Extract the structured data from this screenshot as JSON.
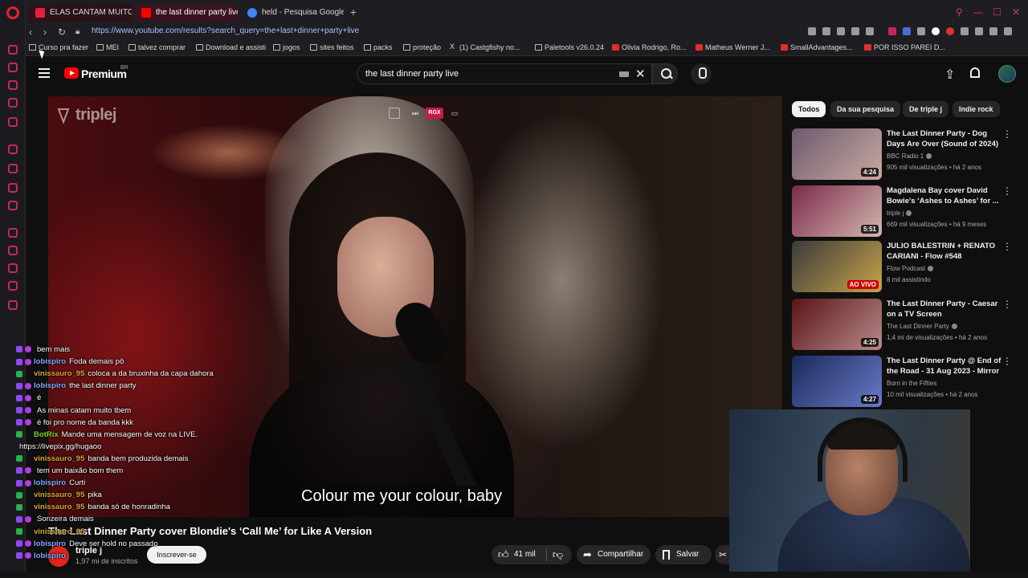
{
  "browser": {
    "tabs": [
      {
        "label": "ELAS CANTAM MUITO!",
        "favicon_color": "#e3203b",
        "active": false
      },
      {
        "label": "the last dinner party live",
        "favicon_color": "#ff0000",
        "active": true
      },
      {
        "label": "held - Pesquisa Google",
        "favicon_color": "#4285f4",
        "active": false
      }
    ],
    "new_tab": "+",
    "url": "https://www.youtube.com/results?search_query=the+last+dinner+party+live",
    "bookmarks": [
      {
        "label": "Curso pra fazer",
        "icon": "folder-icon"
      },
      {
        "label": "MEI",
        "icon": "folder-icon"
      },
      {
        "label": "talvez comprar",
        "icon": "folder-icon"
      },
      {
        "label": "Download e assisti",
        "icon": "folder-icon"
      },
      {
        "label": "jogos",
        "icon": "folder-icon"
      },
      {
        "label": "sites feitos",
        "icon": "folder-icon"
      },
      {
        "label": "packs",
        "icon": "folder-icon"
      },
      {
        "label": "proteção",
        "icon": "folder-icon"
      },
      {
        "label": "(1) Castgfishy no...",
        "icon": "x-icon"
      },
      {
        "label": "Paletools v26.0.24",
        "icon": "page-icon"
      },
      {
        "label": "Olivia Rodrigo, Ro...",
        "icon": "youtube-icon"
      },
      {
        "label": "Matheus Werner J...",
        "icon": "youtube-icon"
      },
      {
        "label": "SmallAdvantages...",
        "icon": "youtube-icon"
      },
      {
        "label": "POR ISSO PAREI D...",
        "icon": "youtube-icon"
      }
    ],
    "accent": "#c8265a"
  },
  "youtube": {
    "brand": "Premium",
    "region": "BR",
    "search_query": "the last dinner party live",
    "chips": [
      "Todos",
      "Da sua pesquisa",
      "De triple j",
      "Indie rock"
    ],
    "video": {
      "watermark": "triplej",
      "rgx_label": "RGX",
      "subtitle": "Colour me your colour, baby",
      "title": "The Last Dinner Party cover Blondie's ‘Call Me’ for Like A Version",
      "channel": "triple j",
      "subscribers": "1,97 mi de inscritos",
      "subscribe_label": "Inscrever-se",
      "likes": "41 mil",
      "share_label": "Compartilhar",
      "save_label": "Salvar"
    },
    "recommendations": [
      {
        "title": "The Last Dinner Party - Dog Days Are Over (Sound of 2024)",
        "channel": "BBC Radio 1",
        "meta": "905 mil visualizações • há 2 anos",
        "duration": "4:24",
        "thumb_colors": [
          "#6b5a6e",
          "#c9a9a0"
        ]
      },
      {
        "title": "Magdalena Bay cover David Bowie's ‘Ashes to Ashes’ for ...",
        "channel": "triple j",
        "meta": "669 mil visualizações • há 9 meses",
        "duration": "5:51",
        "thumb_colors": [
          "#7a2a4a",
          "#d4b7b0"
        ]
      },
      {
        "title": "JULIO BALESTRIN + RENATO CARIANI - Flow #548",
        "channel": "Flow Podcast",
        "meta": "8 mil assistindo",
        "duration": "AO VIVO",
        "thumb_colors": [
          "#3a3a3a",
          "#c7a34a"
        ]
      },
      {
        "title": "The Last Dinner Party - Caesar on a TV Screen",
        "channel": "The Last Dinner Party",
        "meta": "1,4 mi de visualizações • há 2 anos",
        "duration": "4:25",
        "thumb_colors": [
          "#5a1418",
          "#b88a8a"
        ]
      },
      {
        "title": "The Last Dinner Party @ End of the Road - 31 Aug 2023 - Mirror",
        "channel": "Born in the Fifties",
        "meta": "10 mil visualizações • há 2 anos",
        "duration": "4:27",
        "thumb_colors": [
          "#1a2a5a",
          "#6a7ac8"
        ]
      }
    ]
  },
  "chat": [
    {
      "user": "",
      "text": "bem mais",
      "color": "#9147ff",
      "badge": "sub"
    },
    {
      "user": "lobispiro",
      "text": "Foda demais pô",
      "color": "#8aa8ff",
      "badge": "sub"
    },
    {
      "user": "vinissauro_95",
      "text": "coloca a da bruxinha da capa dahora",
      "color": "#d4a53a",
      "badge": "green"
    },
    {
      "user": "lobispiro",
      "text": "the last dinner party",
      "color": "#8aa8ff",
      "badge": "sub"
    },
    {
      "user": "",
      "text": "é",
      "color": "#9147ff",
      "badge": "sub"
    },
    {
      "user": "",
      "text": "As minas catam muito tbem",
      "color": "#9147ff",
      "badge": "sub"
    },
    {
      "user": "",
      "text": "é foi pro nome da banda kkk",
      "color": "#9147ff",
      "badge": "sub"
    },
    {
      "user": "BotRix",
      "text": "Mande uma mensagem de voz na LIVE.",
      "color": "#7ed321",
      "badge": "bot"
    },
    {
      "user": "",
      "text": "https://livepix.gg/hugaoo",
      "color": "#ffffff",
      "badge": "none"
    },
    {
      "user": "vinissauro_95",
      "text": "banda bem produzida demais",
      "color": "#d4a53a",
      "badge": "green"
    },
    {
      "user": "",
      "text": "tem um baixão bom them",
      "color": "#9147ff",
      "badge": "sub"
    },
    {
      "user": "lobispiro",
      "text": "Curti",
      "color": "#8aa8ff",
      "badge": "sub"
    },
    {
      "user": "vinissauro_95",
      "text": "pika",
      "color": "#d4a53a",
      "badge": "green"
    },
    {
      "user": "vinissauro_95",
      "text": "banda só de honradinha",
      "color": "#d4a53a",
      "badge": "green"
    },
    {
      "user": "",
      "text": "Sonzeira demais",
      "color": "#9147ff",
      "badge": "sub"
    },
    {
      "user": "vinissauro_95",
      "text": "",
      "color": "#d4a53a",
      "badge": "green"
    },
    {
      "user": "lobispiro",
      "text": "Deve ser hold no passado",
      "color": "#8aa8ff",
      "badge": "sub"
    },
    {
      "user": "lobispiro",
      "text": "",
      "color": "#8aa8ff",
      "badge": "sub"
    }
  ]
}
